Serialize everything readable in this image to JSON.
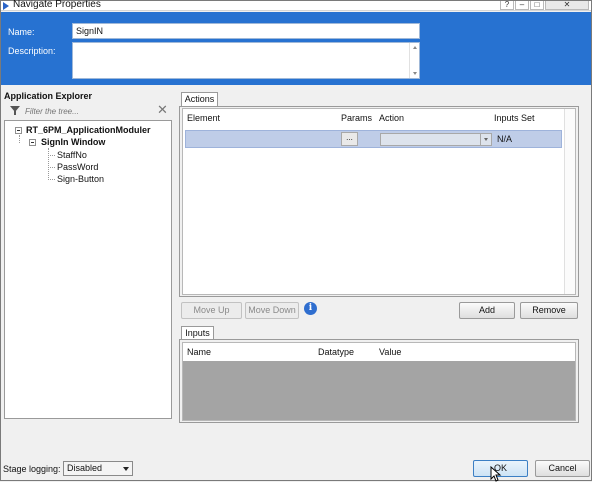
{
  "window": {
    "title": "Navigate Properties",
    "help_label": "?",
    "min_label": "–",
    "max_label": "□",
    "close_label": "✕"
  },
  "header": {
    "name_label": "Name:",
    "name_value": "SignIN",
    "description_label": "Description:",
    "description_value": "",
    "bg_color": "#2772d1"
  },
  "app_explorer": {
    "title": "Application Explorer",
    "filter_placeholder": "Filter the tree...",
    "tree": {
      "root": "RT_6PM_ApplicationModuler",
      "window": "SignIn Window",
      "children": [
        "StaffNo",
        "PassWord",
        "Sign-Button"
      ]
    }
  },
  "actions": {
    "tab_label": "Actions",
    "columns": [
      "Element",
      "Params",
      "Action",
      "Inputs Set"
    ],
    "rows": [
      {
        "element": "",
        "params_button": "...",
        "action": "",
        "inputs_set": "N/A"
      }
    ],
    "selected_row_color": "#bfcde8"
  },
  "action_buttons": {
    "move_up": "Move Up",
    "move_down": "Move Down",
    "info_icon": "i",
    "add": "Add",
    "remove": "Remove"
  },
  "inputs": {
    "tab_label": "Inputs",
    "columns": [
      "Name",
      "Datatype",
      "Value"
    ]
  },
  "footer": {
    "stage_logging_label": "Stage logging:",
    "stage_logging_value": "Disabled",
    "ok": "OK",
    "cancel": "Cancel"
  }
}
